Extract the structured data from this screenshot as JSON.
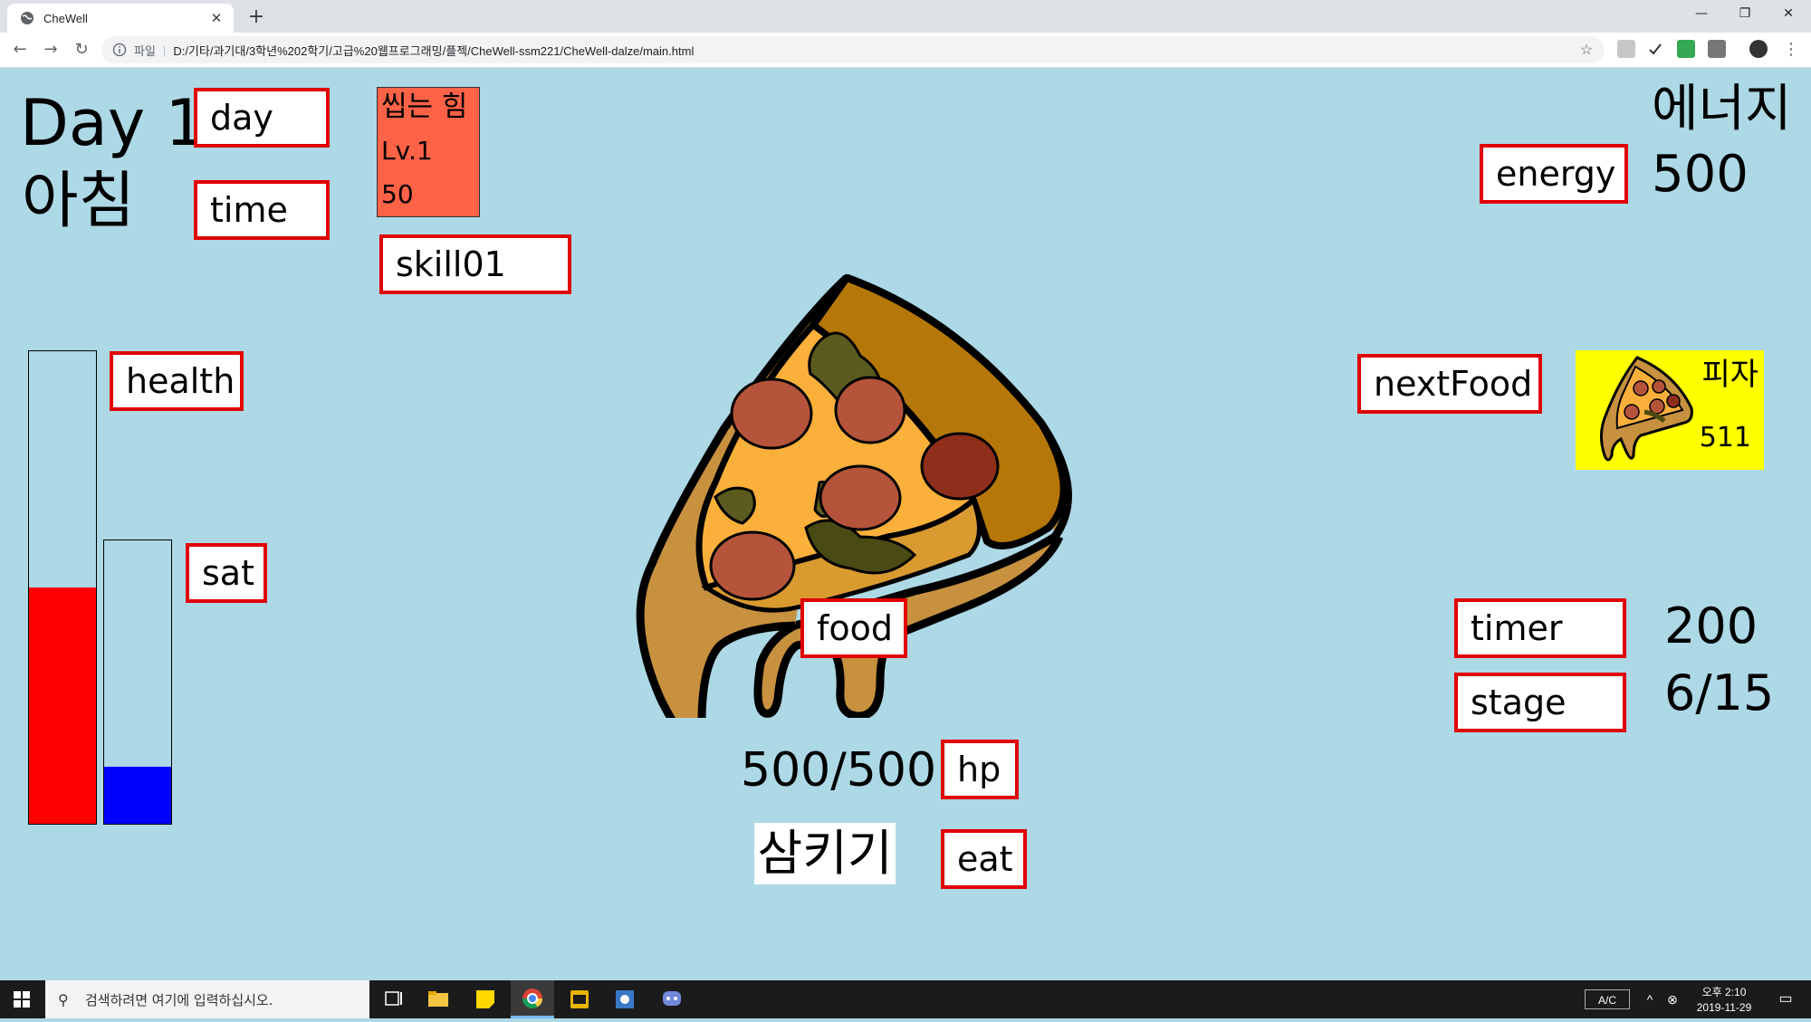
{
  "browser": {
    "tab_title": "CheWell",
    "tab_close": "✕",
    "new_tab": "+",
    "window": {
      "minimize": "—",
      "restore": "❐",
      "close": "✕"
    },
    "nav": {
      "back": "←",
      "forward": "→",
      "reload": "↻"
    },
    "address": {
      "scheme": "파일",
      "url": "D:/기타/과기대/3학년%202학기/고급%20웹프로그래밍/플젝/CheWell-ssm221/CheWell-dalze/main.html"
    },
    "star": "☆",
    "menu": "⋮"
  },
  "game": {
    "day_text": "Day 1",
    "day_label": "day",
    "time_text": "아침",
    "time_label": "time",
    "skill": {
      "name": "씹는 힘",
      "level": "Lv.1",
      "value": "50"
    },
    "skill_label": "skill01",
    "energy_title": "에너지",
    "energy_label": "energy",
    "energy_value": "500",
    "health_label": "health",
    "sat_label": "sat",
    "health_level": 0.5,
    "sat_level": 0.2,
    "health_color": "#ff0000",
    "sat_color": "#0000ff",
    "next_food_label": "nextFood",
    "next_food": {
      "name": "피자",
      "value": "511",
      "bg": "#ffff00"
    },
    "food_label": "food",
    "timer_label": "timer",
    "timer_value": "200",
    "stage_label": "stage",
    "stage_value": "6/15",
    "hp_value": "500/500",
    "hp_label": "hp",
    "eat_word": "삼키기",
    "eat_label": "eat"
  },
  "taskbar": {
    "search_placeholder": "검색하려면 여기에 입력하십시오.",
    "ime": "A/C",
    "clock_time": "오후 2:10",
    "clock_date": "2019-11-29"
  }
}
